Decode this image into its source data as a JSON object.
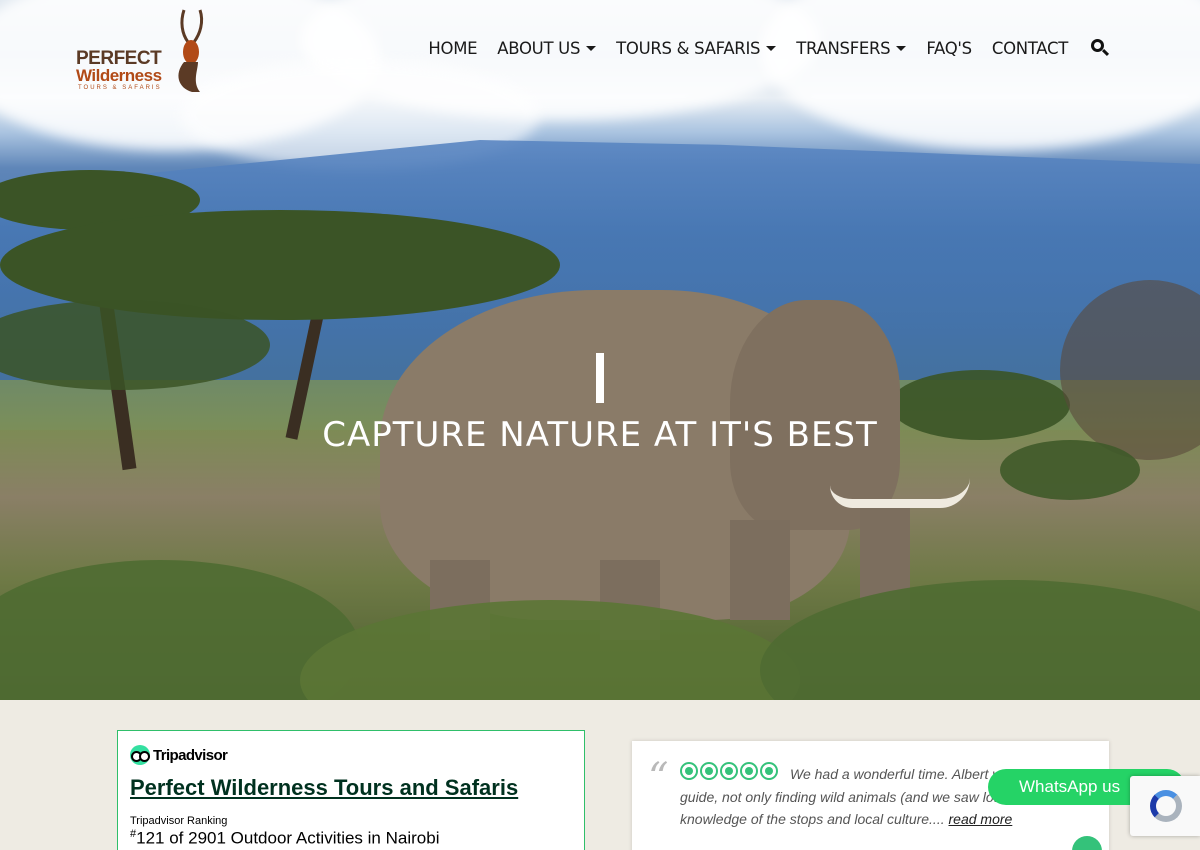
{
  "brand": {
    "line1": "PERFECT",
    "line2": "Wilderness",
    "line3": "TOURS & SAFARIS"
  },
  "nav": {
    "items": [
      {
        "label": "HOME",
        "dropdown": false
      },
      {
        "label": "ABOUT US",
        "dropdown": true
      },
      {
        "label": "TOURS & SAFARIS",
        "dropdown": true
      },
      {
        "label": "TRANSFERS",
        "dropdown": true
      },
      {
        "label": "FAQ'S",
        "dropdown": false
      },
      {
        "label": "CONTACT",
        "dropdown": false
      }
    ],
    "search_icon": "search-icon"
  },
  "hero": {
    "title": "CAPTURE NATURE AT IT'S BEST"
  },
  "tripadvisor": {
    "brand": "Tripadvisor",
    "business_name": "Perfect Wilderness Tours and Safaris",
    "ranking_label": "Tripadvisor Ranking",
    "ranking_hash": "#",
    "ranking_text": "121 of 2901 Outdoor Activities in Nairobi"
  },
  "review": {
    "quote_mark": "“",
    "rating": 5,
    "text": "We had a wonderful time. Albert was a good guide, not only finding wild animals (and we saw lots!) but his knowledge of the stops and local culture....",
    "read_more": "read more"
  },
  "whatsapp": {
    "label": "WhatsApp us"
  },
  "colors": {
    "accent_green": "#25d366",
    "tripadvisor_green": "#34e0a1",
    "brand_brown": "#5b3a25",
    "brand_orange": "#b14a17"
  }
}
